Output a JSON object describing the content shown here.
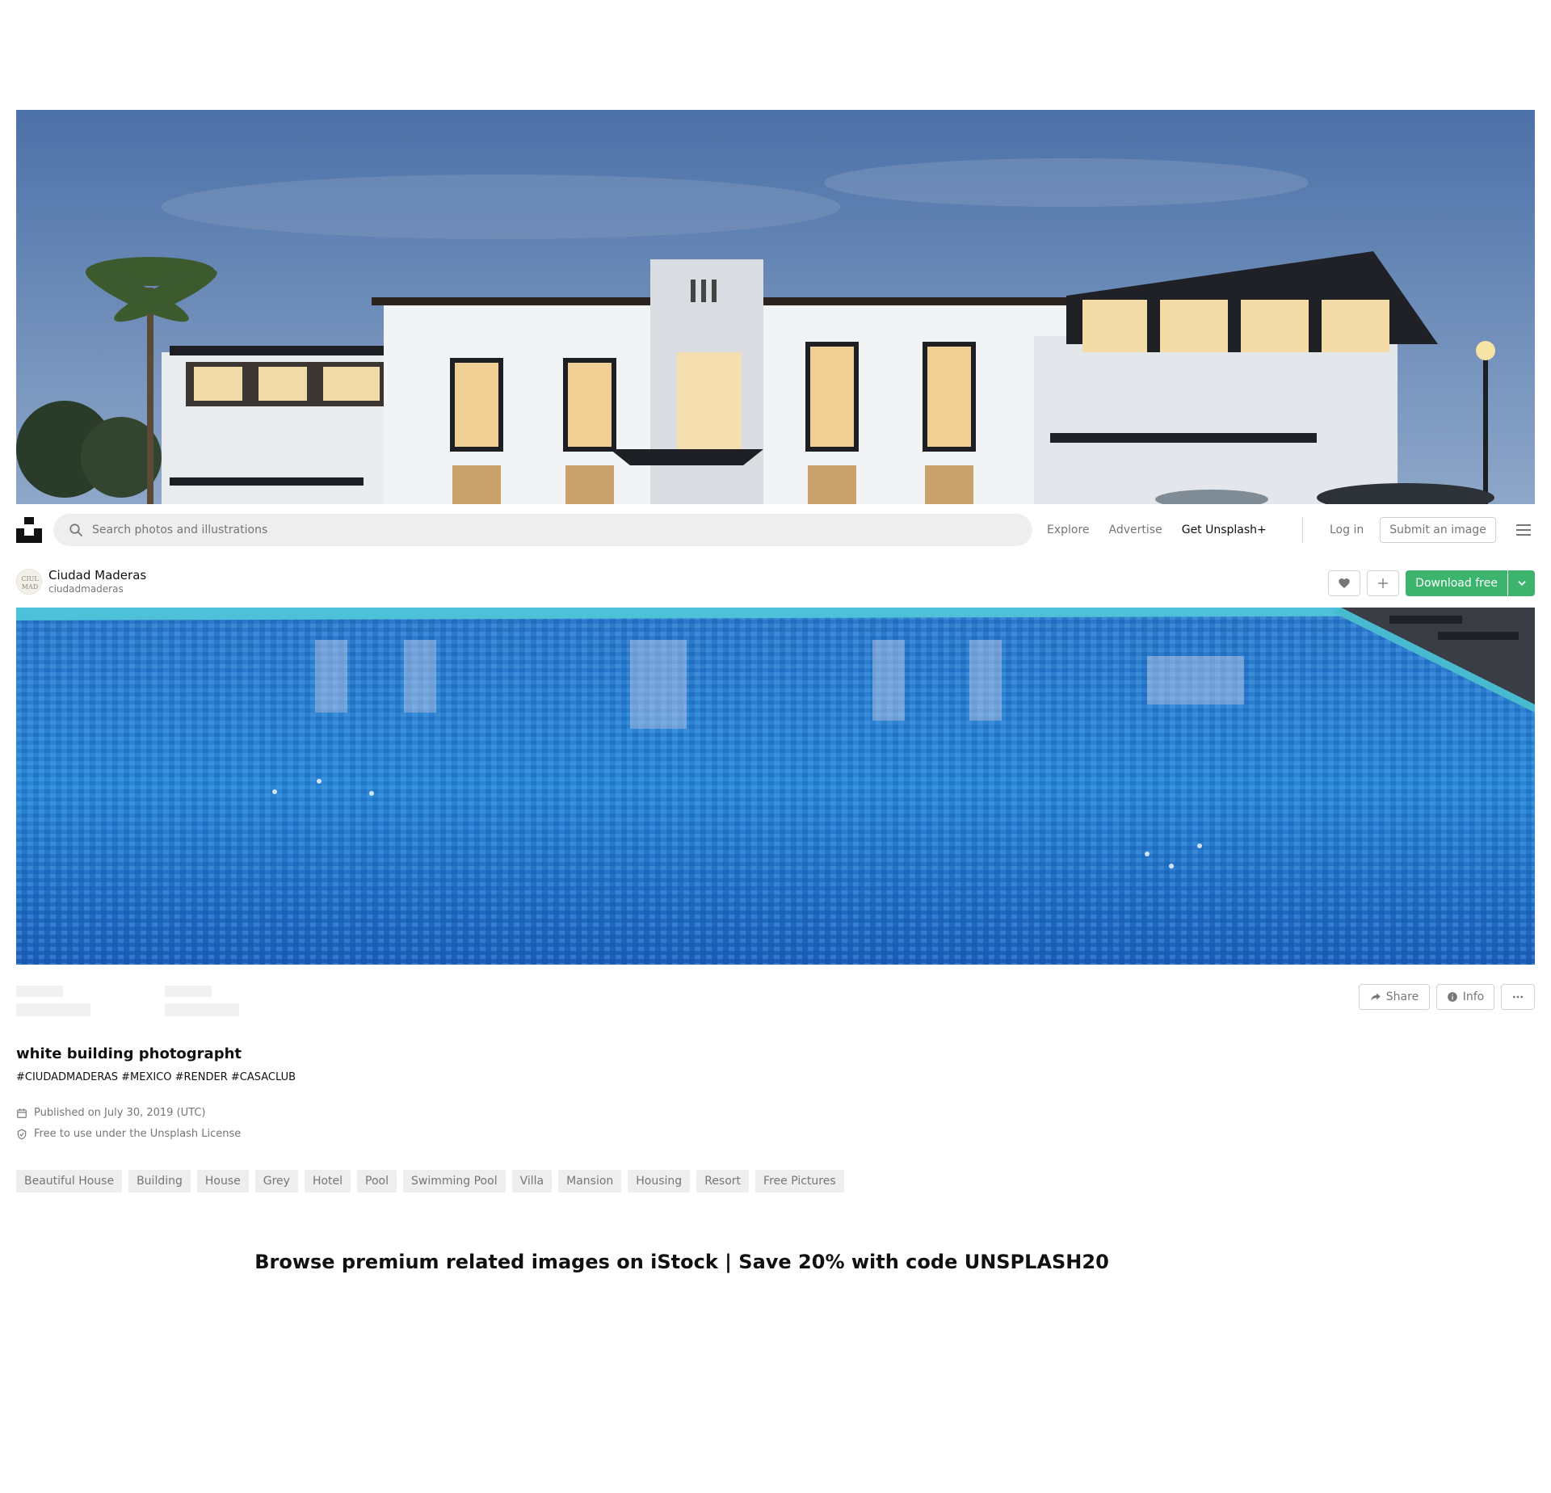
{
  "search": {
    "placeholder": "Search photos and illustrations"
  },
  "nav": {
    "explore": "Explore",
    "advertise": "Advertise",
    "unsplash_plus": "Get Unsplash+",
    "login": "Log in",
    "submit": "Submit an image"
  },
  "author": {
    "name": "Ciudad Maderas",
    "handle": "ciudadmaderas",
    "avatar_text_top": "CIUL",
    "avatar_text_bottom": "MAD"
  },
  "actions": {
    "download": "Download free",
    "share": "Share",
    "info": "Info"
  },
  "photo": {
    "title": "white building photographt",
    "hashtags": "#CIUDADMADERAS #MEXICO #RENDER #CASACLUB",
    "published": "Published on July 30, 2019 (UTC)",
    "license": "Free to use under the Unsplash License"
  },
  "tags": [
    "Beautiful House",
    "Building",
    "House",
    "Grey",
    "Hotel",
    "Pool",
    "Swimming Pool",
    "Villa",
    "Mansion",
    "Housing",
    "Resort",
    "Free Pictures"
  ],
  "istock_banner": "Browse premium related images on iStock | Save 20% with code UNSPLASH20",
  "colors": {
    "accent_green": "#3cb46e",
    "text_muted": "#767676",
    "tag_bg": "#eeeeee"
  },
  "icons": [
    "unsplash-logo",
    "search-icon",
    "menu-icon",
    "heart-icon",
    "plus-icon",
    "chevron-down-icon",
    "share-icon",
    "info-icon",
    "more-icon",
    "calendar-icon",
    "shield-check-icon"
  ]
}
